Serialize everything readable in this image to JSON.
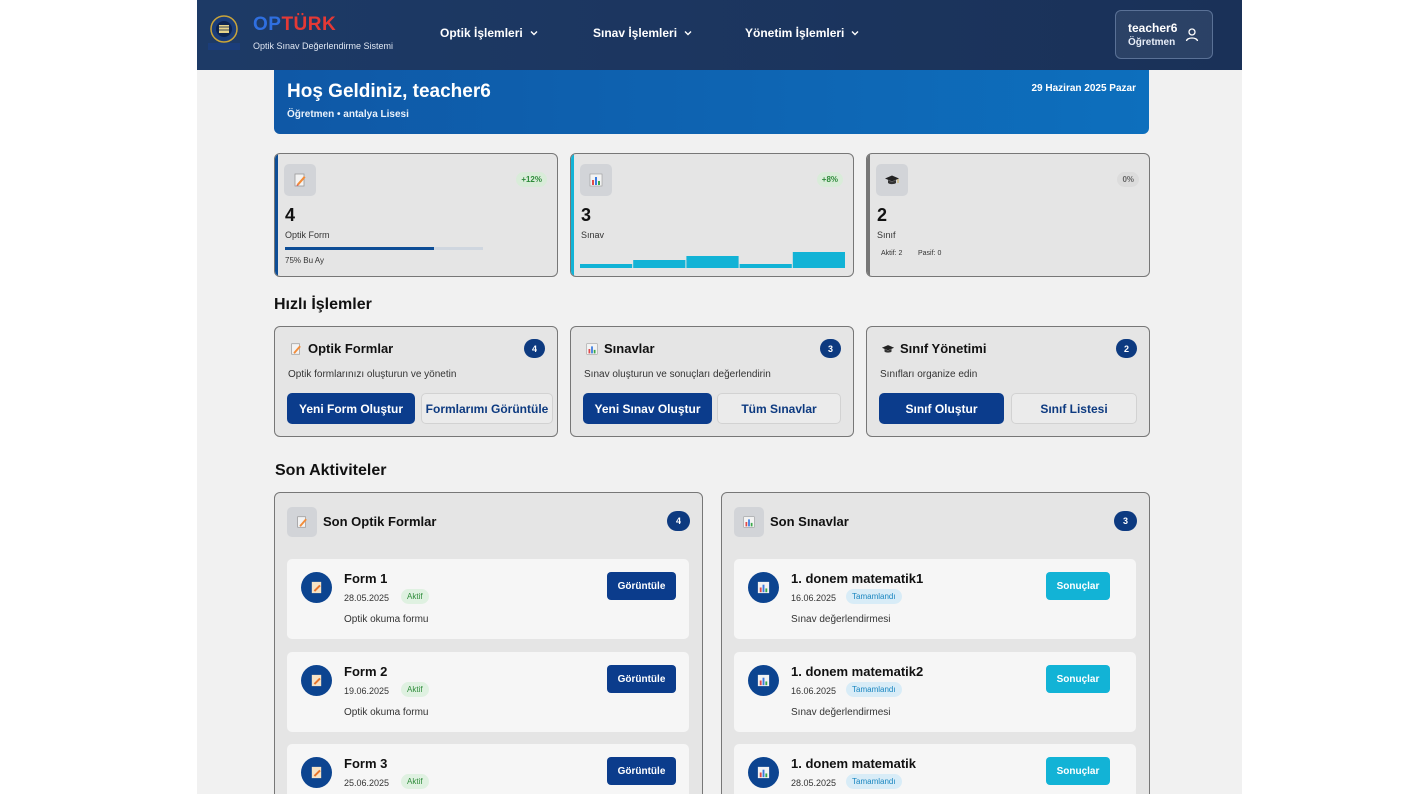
{
  "header": {
    "logo_op": "OP",
    "logo_turk": "TÜRK",
    "logo_sub": "Optik Sınav Değerlendirme Sistemi",
    "nav": [
      {
        "label": "Optik İşlemleri"
      },
      {
        "label": "Sınav İşlemleri"
      },
      {
        "label": "Yönetim İşlemleri"
      }
    ],
    "user_name": "teacher6",
    "user_role": "Öğretmen"
  },
  "welcome": {
    "title": "Hoş Geldiniz, teacher6",
    "subtitle": "Öğretmen • antalya Lisesi",
    "date": "29 Haziran 2025 Pazar"
  },
  "stats": [
    {
      "icon": "pencil-form-icon",
      "trend": "+12%",
      "value": "4",
      "label": "Optik Form",
      "progress_percent": 75,
      "progress_label": "75% Bu Ay"
    },
    {
      "icon": "bar-chart-icon",
      "trend": "+8%",
      "value": "3",
      "label": "Sınav",
      "mini_bar_values": [
        1,
        2,
        3,
        1,
        4
      ]
    },
    {
      "icon": "graduation-cap-icon",
      "trend": "0%",
      "value": "2",
      "label": "Sınıf",
      "active": "Aktif: 2",
      "passive": "Pasif: 0"
    }
  ],
  "quick_title": "Hızlı İşlemler",
  "quick": [
    {
      "title": "Optik Formlar",
      "badge": "4",
      "desc": "Optik formlarınızı oluşturun ve yönetin",
      "primary": "Yeni Form Oluştur",
      "secondary": "Formlarımı Görüntüle"
    },
    {
      "title": "Sınavlar",
      "badge": "3",
      "desc": "Sınav oluşturun ve sonuçları değerlendirin",
      "primary": "Yeni Sınav Oluştur",
      "secondary": "Tüm Sınavlar"
    },
    {
      "title": "Sınıf Yönetimi",
      "badge": "2",
      "desc": "Sınıfları organize edin",
      "primary": "Sınıf Oluştur",
      "secondary": "Sınıf Listesi"
    }
  ],
  "activities_title": "Son Aktiviteler",
  "recent_forms": {
    "title": "Son Optik Formlar",
    "badge": "4",
    "items": [
      {
        "name": "Form 1",
        "date": "28.05.2025",
        "status": "Aktif",
        "desc": "Optik okuma formu",
        "button": "Görüntüle"
      },
      {
        "name": "Form 2",
        "date": "19.06.2025",
        "status": "Aktif",
        "desc": "Optik okuma formu",
        "button": "Görüntüle"
      },
      {
        "name": "Form 3",
        "date": "25.06.2025",
        "status": "Aktif",
        "desc": "",
        "button": "Görüntüle"
      }
    ]
  },
  "recent_exams": {
    "title": "Son Sınavlar",
    "badge": "3",
    "items": [
      {
        "name": "1. donem matematik1",
        "date": "16.06.2025",
        "status": "Tamamlandı",
        "desc": "Sınav değerlendirmesi",
        "button": "Sonuçlar"
      },
      {
        "name": "1. donem matematik2",
        "date": "16.06.2025",
        "status": "Tamamlandı",
        "desc": "Sınav değerlendirmesi",
        "button": "Sonuçlar"
      },
      {
        "name": "1. donem matematik",
        "date": "28.05.2025",
        "status": "Tamamlandı",
        "desc": "",
        "button": "Sonuçlar"
      }
    ]
  },
  "colors": {
    "header_bg": "#1d3a66",
    "primary": "#0b3c8c",
    "welcome_bg": "#0f58a6",
    "accent_cyan": "#12b3d6",
    "status_active_bg": "#dff1e1",
    "status_active_fg": "#2e8b3a",
    "status_done_bg": "#d8ecf7",
    "status_done_fg": "#1a86c0"
  }
}
